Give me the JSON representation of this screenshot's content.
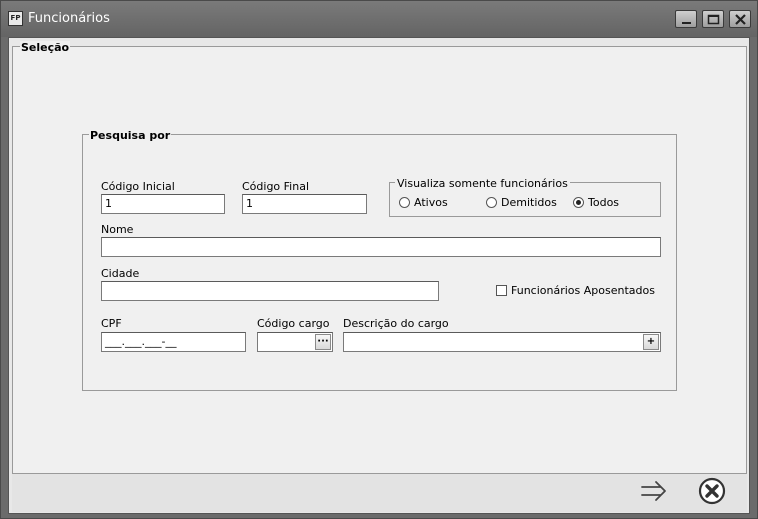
{
  "window": {
    "icon_text": "FP",
    "title": "Funcionários",
    "controls": [
      "minimize-icon",
      "maximize-icon",
      "close-icon"
    ]
  },
  "selecao": {
    "label": "Seleção"
  },
  "pesquisa": {
    "label": "Pesquisa por",
    "codigo_inicial": {
      "label": "Código Inicial",
      "value": "1"
    },
    "codigo_final": {
      "label": "Código Final",
      "value": "1"
    },
    "visualiza": {
      "title": "Visualiza somente funcionários",
      "options": [
        {
          "label": "Ativos",
          "checked": false
        },
        {
          "label": "Demitidos",
          "checked": false
        },
        {
          "label": "Todos",
          "checked": true
        }
      ]
    },
    "nome": {
      "label": "Nome",
      "value": ""
    },
    "cidade": {
      "label": "Cidade",
      "value": ""
    },
    "aposentados": {
      "label": "Funcionários Aposentados",
      "checked": false
    },
    "cpf": {
      "label": "CPF",
      "mask": "___.___.___-__"
    },
    "codigo_cargo": {
      "label": "Código cargo",
      "value": "",
      "button": "···"
    },
    "descricao_cargo": {
      "label": "Descrição do cargo",
      "value": "",
      "button": "+"
    }
  },
  "footer": {
    "buttons": [
      "next-arrow-icon",
      "cancel-x-icon"
    ]
  }
}
